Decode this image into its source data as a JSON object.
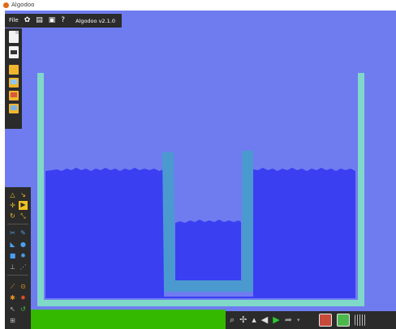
{
  "window": {
    "title": "Algodoo"
  },
  "menu": {
    "file_label": "File",
    "version": "Algodoo v2.1.0"
  },
  "colors": {
    "background": "#6f7cf0",
    "water": "#3a3ff2",
    "outer_container": "#7fd8c8",
    "inner_container": "#4a9ad0",
    "ground": "#35b800",
    "toolbar": "#2b2b2b"
  },
  "icons": {
    "menu": [
      "settings-icon",
      "calculator-icon",
      "save-icon",
      "help-icon"
    ],
    "file_toolbar": [
      "new-scene-icon",
      "save-scene-icon",
      "open-folder-icon",
      "open-folder-blue-icon",
      "open-folder-red-icon",
      "open-folder-image-icon"
    ],
    "bottom_toolbar": [
      "zoom-icon",
      "pan-icon",
      "undo-icon",
      "play-icon",
      "redo-icon",
      "red-rectangle-icon",
      "green-circle-icon",
      "grid-icon"
    ]
  }
}
